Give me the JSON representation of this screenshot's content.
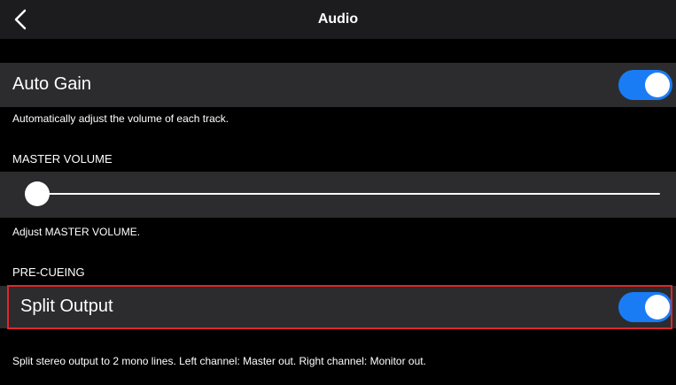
{
  "nav": {
    "title": "Audio",
    "back_icon": "chevron-left-icon"
  },
  "auto_gain": {
    "label": "Auto Gain",
    "enabled": true,
    "caption": "Automatically adjust the volume of each track."
  },
  "master_volume": {
    "header": "MASTER VOLUME",
    "value_fraction": 0.0,
    "caption": "Adjust MASTER VOLUME."
  },
  "pre_cueing": {
    "header": "PRE-CUEING"
  },
  "split_output": {
    "label": "Split Output",
    "enabled": true,
    "caption": "Split stereo output to 2 mono lines. Left channel: Master out. Right channel: Monitor out."
  },
  "colors": {
    "toggle_on": "#1a7cf5",
    "highlight": "#e0262a",
    "row_background": "#2c2c2e",
    "nav_background": "#1c1c1e"
  }
}
